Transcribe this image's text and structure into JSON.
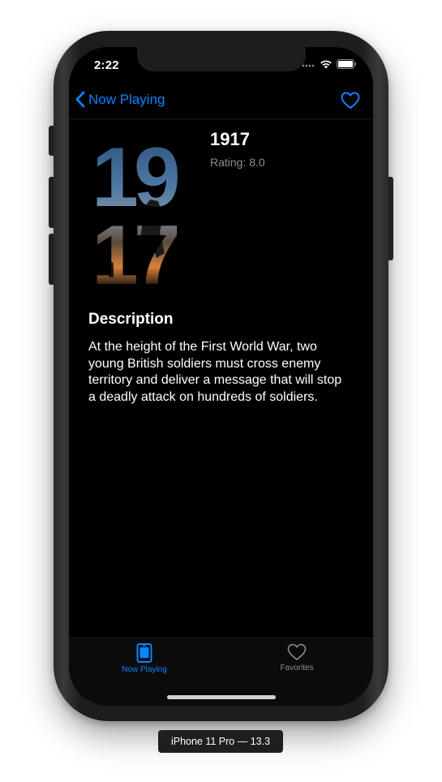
{
  "status_bar": {
    "time": "2:22"
  },
  "nav": {
    "back_label": "Now Playing",
    "back_icon": "chevron-left-icon",
    "favorite_icon": "heart-outline-icon"
  },
  "movie": {
    "title": "1917",
    "rating_text": "Rating: 8.0",
    "poster_text": [
      "19",
      "17"
    ]
  },
  "description": {
    "heading": "Description",
    "text": "At the height of the First World War, two young British soldiers must cross enemy territory and deliver a message that will stop a deadly attack on hundreds of soldiers."
  },
  "tab_bar": {
    "tabs": [
      {
        "label": "Now Playing",
        "icon": "phone-screen-icon",
        "selected": true
      },
      {
        "label": "Favorites",
        "icon": "heart-outline-icon",
        "selected": false
      }
    ]
  },
  "device_label": "iPhone 11 Pro — 13.3",
  "colors": {
    "accent": "#0a84ff",
    "background": "#000000",
    "secondary_text": "#8e8e93"
  }
}
